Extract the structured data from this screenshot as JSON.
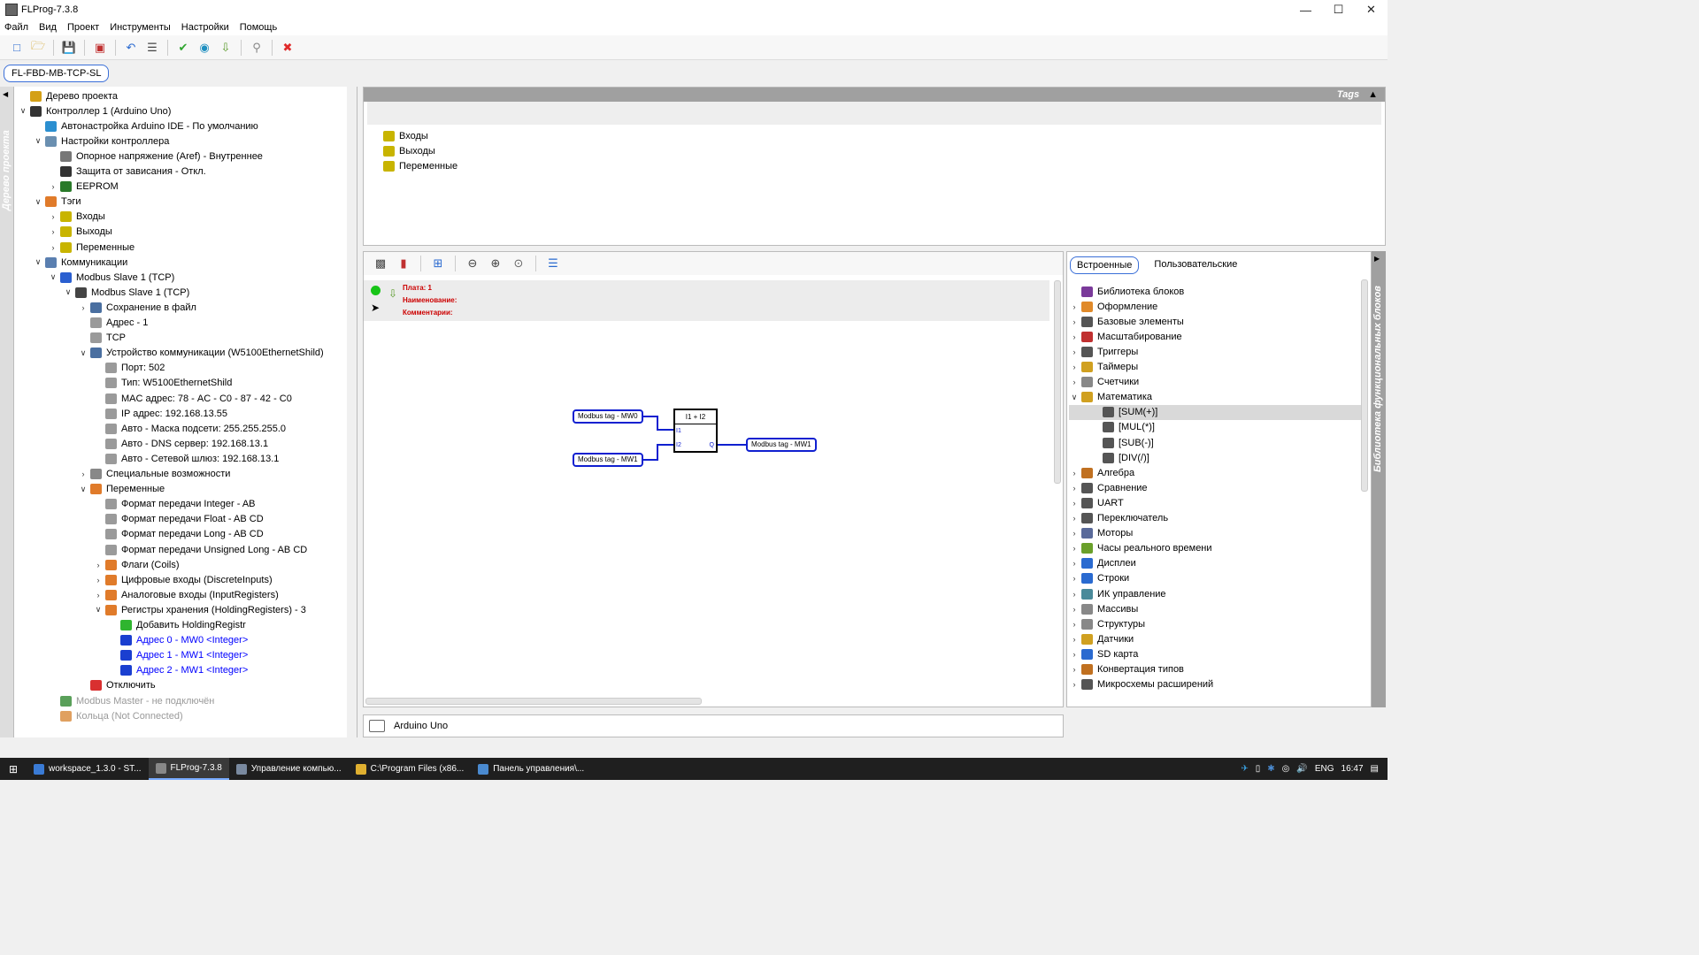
{
  "window": {
    "title": "FLProg-7.3.8"
  },
  "menu": [
    "Файл",
    "Вид",
    "Проект",
    "Инструменты",
    "Настройки",
    "Помощь"
  ],
  "project_tab": "FL-FBD-MB-TCP-SL",
  "left_strip_label": "Дерево проекта",
  "tree": [
    {
      "level": 0,
      "chev": "",
      "label": "Дерево проекта",
      "icon": "project-tree-icon",
      "color": "#d4a017",
      "style": ""
    },
    {
      "level": 0,
      "chev": "v",
      "label": "Контроллер 1 (Arduino Uno)",
      "icon": "controller-icon",
      "color": "#333333",
      "style": ""
    },
    {
      "level": 1,
      "chev": "",
      "label": "Автонастройка Arduino IDE - По умолчанию",
      "icon": "infinity-icon",
      "color": "#2b8fd0",
      "style": ""
    },
    {
      "level": 1,
      "chev": "v",
      "label": "Настройки контроллера",
      "icon": "tools-icon",
      "color": "#6a8fb0",
      "style": ""
    },
    {
      "level": 2,
      "chev": "",
      "label": "Опорное напряжение (Aref) - Внутреннее",
      "icon": "gauge-icon",
      "color": "#777777",
      "style": ""
    },
    {
      "level": 2,
      "chev": "",
      "label": "Защита от зависания - Откл.",
      "icon": "shield-icon",
      "color": "#333333",
      "style": ""
    },
    {
      "level": 2,
      "chev": ">",
      "label": "EEPROM",
      "icon": "chip-icon",
      "color": "#2a7a2a",
      "style": ""
    },
    {
      "level": 1,
      "chev": "v",
      "label": "Тэги",
      "icon": "tags-icon",
      "color": "#e07b2a",
      "style": ""
    },
    {
      "level": 2,
      "chev": ">",
      "label": "Входы",
      "icon": "inputs-icon",
      "color": "#c8b400",
      "style": ""
    },
    {
      "level": 2,
      "chev": ">",
      "label": "Выходы",
      "icon": "outputs-icon",
      "color": "#c8b400",
      "style": ""
    },
    {
      "level": 2,
      "chev": ">",
      "label": "Переменные",
      "icon": "variables-icon",
      "color": "#c8b400",
      "style": ""
    },
    {
      "level": 1,
      "chev": "v",
      "label": "Коммуникации",
      "icon": "network-icon",
      "color": "#5a7fb0",
      "style": ""
    },
    {
      "level": 2,
      "chev": "v",
      "label": "Modbus Slave 1 (TCP)",
      "icon": "modbus-icon",
      "color": "#2a5fd0",
      "style": ""
    },
    {
      "level": 3,
      "chev": "v",
      "label": "Modbus Slave 1 (TCP)",
      "icon": "device-icon",
      "color": "#444444",
      "style": ""
    },
    {
      "level": 4,
      "chev": ">",
      "label": "Сохранение в файл",
      "icon": "save-icon",
      "color": "#4a6fa0",
      "style": ""
    },
    {
      "level": 4,
      "chev": "",
      "label": "Адрес - 1",
      "icon": "param-icon",
      "color": "#9a9a9a",
      "style": ""
    },
    {
      "level": 4,
      "chev": "",
      "label": "TCP",
      "icon": "param-icon",
      "color": "#9a9a9a",
      "style": ""
    },
    {
      "level": 4,
      "chev": "v",
      "label": "Устройство коммуникации (W5100EthernetShild)",
      "icon": "ethernet-icon",
      "color": "#4a6fa0",
      "style": ""
    },
    {
      "level": 5,
      "chev": "",
      "label": "Порт: 502",
      "icon": "param-icon",
      "color": "#9a9a9a",
      "style": ""
    },
    {
      "level": 5,
      "chev": "",
      "label": "Тип: W5100EthernetShild",
      "icon": "param-icon",
      "color": "#9a9a9a",
      "style": ""
    },
    {
      "level": 5,
      "chev": "",
      "label": "MAC адрес: 78 - AC - C0 - 87 - 42 - C0",
      "icon": "param-icon",
      "color": "#9a9a9a",
      "style": ""
    },
    {
      "level": 5,
      "chev": "",
      "label": "IP адрес: 192.168.13.55",
      "icon": "param-icon",
      "color": "#9a9a9a",
      "style": ""
    },
    {
      "level": 5,
      "chev": "",
      "label": "Авто - Маска подсети: 255.255.255.0",
      "icon": "param-icon",
      "color": "#9a9a9a",
      "style": ""
    },
    {
      "level": 5,
      "chev": "",
      "label": "Авто - DNS сервер: 192.168.13.1",
      "icon": "param-icon",
      "color": "#9a9a9a",
      "style": ""
    },
    {
      "level": 5,
      "chev": "",
      "label": "Авто - Сетевой шлюз: 192.168.13.1",
      "icon": "param-icon",
      "color": "#9a9a9a",
      "style": ""
    },
    {
      "level": 4,
      "chev": ">",
      "label": "Специальные возможности",
      "icon": "gear-icon",
      "color": "#888888",
      "style": ""
    },
    {
      "level": 4,
      "chev": "v",
      "label": "Переменные",
      "icon": "variables-icon",
      "color": "#e07b2a",
      "style": ""
    },
    {
      "level": 5,
      "chev": "",
      "label": "Формат передачи Integer - AB",
      "icon": "param-icon",
      "color": "#9a9a9a",
      "style": ""
    },
    {
      "level": 5,
      "chev": "",
      "label": "Формат передачи Float - AB CD",
      "icon": "param-icon",
      "color": "#9a9a9a",
      "style": ""
    },
    {
      "level": 5,
      "chev": "",
      "label": "Формат передачи Long - AB CD",
      "icon": "param-icon",
      "color": "#9a9a9a",
      "style": ""
    },
    {
      "level": 5,
      "chev": "",
      "label": "Формат передачи Unsigned Long - AB CD",
      "icon": "param-icon",
      "color": "#9a9a9a",
      "style": ""
    },
    {
      "level": 5,
      "chev": ">",
      "label": "Флаги (Coils)",
      "icon": "coils-icon",
      "color": "#e07b2a",
      "style": ""
    },
    {
      "level": 5,
      "chev": ">",
      "label": "Цифровые входы (DiscreteInputs)",
      "icon": "discrete-inputs-icon",
      "color": "#e07b2a",
      "style": ""
    },
    {
      "level": 5,
      "chev": ">",
      "label": "Аналоговые входы (InputRegisters)",
      "icon": "input-registers-icon",
      "color": "#e07b2a",
      "style": ""
    },
    {
      "level": 5,
      "chev": "v",
      "label": "Регистры хранения (HoldingRegisters) - 3",
      "icon": "holding-registers-icon",
      "color": "#e07b2a",
      "style": ""
    },
    {
      "level": 6,
      "chev": "",
      "label": "Добавить HoldingRegistr",
      "icon": "add-icon",
      "color": "#2fb52f",
      "style": ""
    },
    {
      "level": 6,
      "chev": "",
      "label": "Адрес 0 - MW0 <Integer>",
      "icon": "link-icon",
      "color": "#1a3fd0",
      "style": "link"
    },
    {
      "level": 6,
      "chev": "",
      "label": "Адрес 1 - MW1 <Integer>",
      "icon": "link-icon",
      "color": "#1a3fd0",
      "style": "link"
    },
    {
      "level": 6,
      "chev": "",
      "label": "Адрес 2 - MW1 <Integer>",
      "icon": "link-icon",
      "color": "#1a3fd0",
      "style": "link"
    },
    {
      "level": 4,
      "chev": "",
      "label": "Отключить",
      "icon": "disable-icon",
      "color": "#d93030",
      "style": ""
    },
    {
      "level": 2,
      "chev": "",
      "label": "Modbus Master - не подключён",
      "icon": "modbus-master-icon",
      "color": "#5aa05a",
      "style": "muted"
    },
    {
      "level": 2,
      "chev": "",
      "label": "Кольца (Not Connected)",
      "icon": "rings-icon",
      "color": "#e0a060",
      "style": "muted"
    }
  ],
  "tags_panel": {
    "header": "Tags",
    "items": [
      "Входы",
      "Выходы",
      "Переменные"
    ]
  },
  "board": {
    "plate": "Плата: 1",
    "name": "Наименование:",
    "comment": "Комментарии:"
  },
  "diagram": {
    "input1": "Modbus tag - MW0",
    "input2": "Modbus tag - MW1",
    "output": "Modbus tag - MW1",
    "block_title": "I1 + I2",
    "pin_i1": "I1",
    "pin_i2": "I2",
    "pin_q": "Q"
  },
  "status": {
    "controller": "Arduino Uno"
  },
  "library": {
    "tabs": [
      "Встроенные",
      "Пользовательские"
    ],
    "side_label": "Библиотека функциональных блоков",
    "items": [
      {
        "level": 0,
        "chev": "",
        "label": "Библиотека блоков",
        "icon": "library-icon",
        "color": "#7a3a9a",
        "sel": false
      },
      {
        "level": 0,
        "chev": ">",
        "label": "Оформление",
        "icon": "design-icon",
        "color": "#e08a2a",
        "sel": false
      },
      {
        "level": 0,
        "chev": ">",
        "label": "Базовые элементы",
        "icon": "basic-elements-icon",
        "color": "#555555",
        "sel": false
      },
      {
        "level": 0,
        "chev": ">",
        "label": "Масштабирование",
        "icon": "scaling-icon",
        "color": "#c03030",
        "sel": false
      },
      {
        "level": 0,
        "chev": ">",
        "label": "Триггеры",
        "icon": "trigger-icon",
        "color": "#555555",
        "sel": false
      },
      {
        "level": 0,
        "chev": ">",
        "label": "Таймеры",
        "icon": "timer-icon",
        "color": "#d0a020",
        "sel": false
      },
      {
        "level": 0,
        "chev": ">",
        "label": "Счетчики",
        "icon": "counter-icon",
        "color": "#888888",
        "sel": false
      },
      {
        "level": 0,
        "chev": "v",
        "label": "Математика",
        "icon": "math-icon",
        "color": "#d0a020",
        "sel": false
      },
      {
        "level": 1,
        "chev": "",
        "label": "[SUM(+)]",
        "icon": "plus-icon",
        "color": "#555555",
        "sel": true
      },
      {
        "level": 1,
        "chev": "",
        "label": "[MUL(*)]",
        "icon": "multiply-icon",
        "color": "#555555",
        "sel": false
      },
      {
        "level": 1,
        "chev": "",
        "label": "[SUB(-)]",
        "icon": "minus-icon",
        "color": "#555555",
        "sel": false
      },
      {
        "level": 1,
        "chev": "",
        "label": "[DIV(/)]",
        "icon": "divide-icon",
        "color": "#555555",
        "sel": false
      },
      {
        "level": 0,
        "chev": ">",
        "label": "Алгебра",
        "icon": "algebra-icon",
        "color": "#c07020",
        "sel": false
      },
      {
        "level": 0,
        "chev": ">",
        "label": "Сравнение",
        "icon": "compare-icon",
        "color": "#555555",
        "sel": false
      },
      {
        "level": 0,
        "chev": ">",
        "label": "UART",
        "icon": "uart-icon",
        "color": "#555555",
        "sel": false
      },
      {
        "level": 0,
        "chev": ">",
        "label": "Переключатель",
        "icon": "switch-icon",
        "color": "#555555",
        "sel": false
      },
      {
        "level": 0,
        "chev": ">",
        "label": "Моторы",
        "icon": "motor-icon",
        "color": "#5a6a9a",
        "sel": false
      },
      {
        "level": 0,
        "chev": ">",
        "label": "Часы реального времени",
        "icon": "clock-icon",
        "color": "#6aa02a",
        "sel": false
      },
      {
        "level": 0,
        "chev": ">",
        "label": "Дисплеи",
        "icon": "display-icon",
        "color": "#2a6ad0",
        "sel": false
      },
      {
        "level": 0,
        "chev": ">",
        "label": "Строки",
        "icon": "strings-icon",
        "color": "#2a6ad0",
        "sel": false
      },
      {
        "level": 0,
        "chev": ">",
        "label": "ИК управление",
        "icon": "ir-icon",
        "color": "#4a8a9a",
        "sel": false
      },
      {
        "level": 0,
        "chev": ">",
        "label": "Массивы",
        "icon": "array-icon",
        "color": "#888888",
        "sel": false
      },
      {
        "level": 0,
        "chev": ">",
        "label": "Структуры",
        "icon": "struct-icon",
        "color": "#888888",
        "sel": false
      },
      {
        "level": 0,
        "chev": ">",
        "label": "Датчики",
        "icon": "sensor-icon",
        "color": "#d0a020",
        "sel": false
      },
      {
        "level": 0,
        "chev": ">",
        "label": "SD карта",
        "icon": "sd-card-icon",
        "color": "#2a6ad0",
        "sel": false
      },
      {
        "level": 0,
        "chev": ">",
        "label": "Конвертация типов",
        "icon": "convert-icon",
        "color": "#c07020",
        "sel": false
      },
      {
        "level": 0,
        "chev": ">",
        "label": "Микросхемы расширений",
        "icon": "ic-icon",
        "color": "#555555",
        "sel": false
      }
    ]
  },
  "taskbar": {
    "tasks": [
      "workspace_1.3.0 - ST...",
      "FLProg-7.3.8",
      "Управление компью...",
      "C:\\Program Files (x86...",
      "Панель управления\\..."
    ],
    "lang": "ENG",
    "time": "16:47"
  }
}
